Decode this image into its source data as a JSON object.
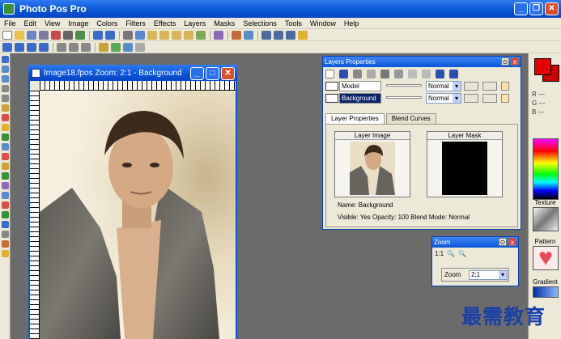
{
  "app": {
    "title": "Photo Pos Pro"
  },
  "menu": [
    "File",
    "Edit",
    "View",
    "Image",
    "Colors",
    "Filters",
    "Effects",
    "Layers",
    "Masks",
    "Selections",
    "Tools",
    "Window",
    "Help"
  ],
  "colors": {
    "foreground": "#e00000",
    "background": "#cc0000",
    "accent": "#0a55d8"
  },
  "color_readout": {
    "r": "R ---",
    "g": "G ---",
    "b": "B ---"
  },
  "right_panel": {
    "texture_label": "Texture",
    "pattern_label": "Pattern",
    "gradient_label": "Gradient"
  },
  "image_window": {
    "title": "Image18.fpos  Zoom: 2:1 - Background"
  },
  "layers_panel": {
    "title": "Layers Properties",
    "layers": [
      {
        "name": "Model",
        "blend": "Normal",
        "selected": false
      },
      {
        "name": "Background",
        "blend": "Normal",
        "selected": true
      }
    ],
    "tabs": [
      {
        "label": "Layer Properties",
        "active": true
      },
      {
        "label": "Blend Curves",
        "active": false
      }
    ],
    "layer_image_label": "Layer Image",
    "layer_mask_label": "Layer Mask",
    "name_line": "Name:  Background",
    "info_line": "Visible: Yes   Opacity: 100   Blend Mode: Normal"
  },
  "zoom_panel": {
    "title": "Zoom",
    "ratio_label": "1:1",
    "field_label": "Zoom",
    "value": "2:1"
  },
  "watermark": "最需教育"
}
